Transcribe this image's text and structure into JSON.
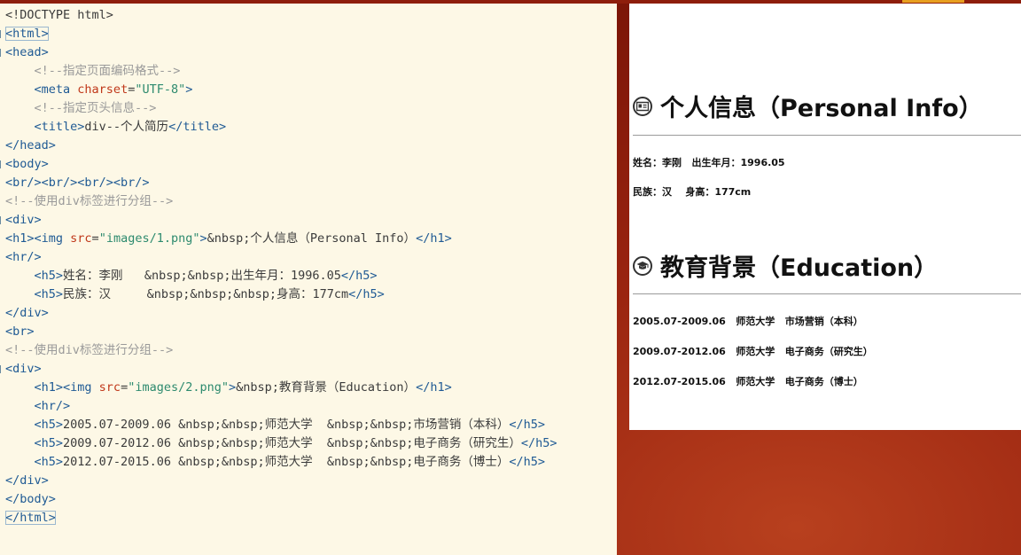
{
  "editor": {
    "lines": [
      [
        {
          "c": "tx",
          "t": "<!DOCTYPE html>"
        }
      ],
      [
        {
          "c": "tg",
          "t": "<html>"
        }
      ],
      [
        {
          "c": "tg",
          "t": "<head>"
        }
      ],
      [
        {
          "c": "cm",
          "t": "    <!--指定页面编码格式-->"
        }
      ],
      [
        {
          "c": "tx",
          "t": "    "
        },
        {
          "c": "tg",
          "t": "<meta "
        },
        {
          "c": "at",
          "t": "charset"
        },
        {
          "c": "tx",
          "t": "="
        },
        {
          "c": "av",
          "t": "\"UTF-8\""
        },
        {
          "c": "tg",
          "t": ">"
        }
      ],
      [
        {
          "c": "cm",
          "t": "    <!--指定页头信息-->"
        }
      ],
      [
        {
          "c": "tx",
          "t": "    "
        },
        {
          "c": "tg",
          "t": "<title>"
        },
        {
          "c": "tx",
          "t": "div--个人简历"
        },
        {
          "c": "tg",
          "t": "</title>"
        }
      ],
      [
        {
          "c": "tg",
          "t": "</head>"
        }
      ],
      [
        {
          "c": "tg",
          "t": "<body>"
        }
      ],
      [
        {
          "c": "tg",
          "t": "<br/><br/><br/><br/>"
        }
      ],
      [
        {
          "c": "cm",
          "t": "<!--使用div标签进行分组-->"
        }
      ],
      [
        {
          "c": "tg",
          "t": "<div>"
        }
      ],
      [
        {
          "c": "tg",
          "t": "<h1><img "
        },
        {
          "c": "at",
          "t": "src"
        },
        {
          "c": "tx",
          "t": "="
        },
        {
          "c": "av",
          "t": "\"images/1.png\""
        },
        {
          "c": "tg",
          "t": ">"
        },
        {
          "c": "tx",
          "t": "&nbsp;个人信息（Personal Info）"
        },
        {
          "c": "tg",
          "t": "</h1>"
        }
      ],
      [
        {
          "c": "tg",
          "t": "<hr/>"
        }
      ],
      [
        {
          "c": "tx",
          "t": "    "
        },
        {
          "c": "tg",
          "t": "<h5>"
        },
        {
          "c": "tx",
          "t": "姓名：李刚   &nbsp;&nbsp;出生年月：1996.05"
        },
        {
          "c": "tg",
          "t": "</h5>"
        }
      ],
      [
        {
          "c": "tx",
          "t": "    "
        },
        {
          "c": "tg",
          "t": "<h5>"
        },
        {
          "c": "tx",
          "t": "民族：汉     &nbsp;&nbsp;&nbsp;身高：177cm"
        },
        {
          "c": "tg",
          "t": "</h5>"
        }
      ],
      [
        {
          "c": "tg",
          "t": "</div>"
        }
      ],
      [
        {
          "c": "tg",
          "t": "<br>"
        }
      ],
      [
        {
          "c": "cm",
          "t": "<!--使用div标签进行分组-->"
        }
      ],
      [
        {
          "c": "tg",
          "t": "<div>"
        }
      ],
      [
        {
          "c": "tx",
          "t": "    "
        },
        {
          "c": "tg",
          "t": "<h1><img "
        },
        {
          "c": "at",
          "t": "src"
        },
        {
          "c": "tx",
          "t": "="
        },
        {
          "c": "av",
          "t": "\"images/2.png\""
        },
        {
          "c": "tg",
          "t": ">"
        },
        {
          "c": "tx",
          "t": "&nbsp;教育背景（Education）"
        },
        {
          "c": "tg",
          "t": "</h1>"
        }
      ],
      [
        {
          "c": "tx",
          "t": "    "
        },
        {
          "c": "tg",
          "t": "<hr/>"
        }
      ],
      [
        {
          "c": "tx",
          "t": "    "
        },
        {
          "c": "tg",
          "t": "<h5>"
        },
        {
          "c": "tx",
          "t": "2005.07-2009.06 &nbsp;&nbsp;师范大学  &nbsp;&nbsp;市场营销（本科）"
        },
        {
          "c": "tg",
          "t": "</h5>"
        }
      ],
      [
        {
          "c": "tx",
          "t": "    "
        },
        {
          "c": "tg",
          "t": "<h5>"
        },
        {
          "c": "tx",
          "t": "2009.07-2012.06 &nbsp;&nbsp;师范大学  &nbsp;&nbsp;电子商务（研究生）"
        },
        {
          "c": "tg",
          "t": "</h5>"
        }
      ],
      [
        {
          "c": "tx",
          "t": "    "
        },
        {
          "c": "tg",
          "t": "<h5>"
        },
        {
          "c": "tx",
          "t": "2012.07-2015.06 &nbsp;&nbsp;师范大学  &nbsp;&nbsp;电子商务（博士）"
        },
        {
          "c": "tg",
          "t": "</h5>"
        }
      ],
      [
        {
          "c": "tg",
          "t": "</div>"
        }
      ],
      [
        {
          "c": "tg",
          "t": "</body>"
        }
      ],
      [
        {
          "c": "tg",
          "t": "</html>"
        }
      ]
    ]
  },
  "preview": {
    "personal": {
      "heading": "个人信息（Personal Info）",
      "icon": "id-card-icon",
      "name_line": "姓名：李刚   出生年月：1996.05",
      "ethnic_line": "民族：汉    身高：177cm"
    },
    "education": {
      "heading": "教育背景（Education）",
      "icon": "graduation-cap-icon",
      "entries": [
        "2005.07-2009.06   师范大学   市场营销（本科）",
        "2009.07-2012.06   师范大学   电子商务（研究生）",
        "2012.07-2015.06   师范大学   电子商务（博士）"
      ]
    }
  },
  "colors": {
    "editor_bg": "#fdf8e6",
    "tag": "#1f5a94",
    "attr": "#c0381a",
    "value": "#2d8a6e",
    "comment": "#9a9a9a",
    "desktop_bg": "#9a2410",
    "accent": "#e8a020"
  }
}
